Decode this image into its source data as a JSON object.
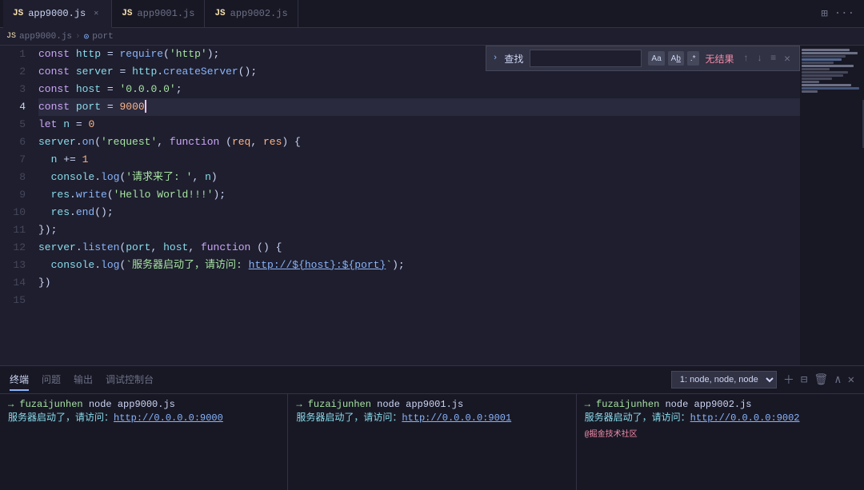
{
  "tabs": [
    {
      "id": "app9000",
      "icon": "JS",
      "label": "app9000.js",
      "active": true,
      "closable": true
    },
    {
      "id": "app9001",
      "icon": "JS",
      "label": "app9001.js",
      "active": false,
      "closable": false
    },
    {
      "id": "app9002",
      "icon": "JS",
      "label": "app9002.js",
      "active": false,
      "closable": false
    }
  ],
  "breadcrumb": {
    "file": "app9000.js",
    "symbol": "port"
  },
  "search": {
    "placeholder": "查找",
    "label": "查找",
    "no_result": "无结果",
    "opt1": "Aa",
    "opt2": "Ab",
    "opt3": ".*"
  },
  "code_lines": [
    {
      "num": 1,
      "content_html": "<span class='kw'>const</span> <span class='var-name'>http</span> <span class='op'>=</span> <span class='fn'>require</span><span class='punc'>(</span><span class='str'>'http'</span><span class='punc'>);</span>"
    },
    {
      "num": 2,
      "content_html": "<span class='kw'>const</span> <span class='var-name'>server</span> <span class='op'>=</span> <span class='var-name'>http</span><span class='punc'>.</span><span class='fn'>createServer</span><span class='punc'>();</span>"
    },
    {
      "num": 3,
      "content_html": "<span class='kw'>const</span> <span class='var-name'>host</span> <span class='op'>=</span> <span class='str'>'0.0.0.0'</span><span class='punc'>;</span>"
    },
    {
      "num": 4,
      "content_html": "<span class='kw'>const</span> <span class='var-name'>port</span> <span class='op'>=</span> <span class='num'>9000</span><span class='cursor'></span>",
      "active": true
    },
    {
      "num": 5,
      "content_html": "<span class='kw'>let</span> <span class='var-name'>n</span> <span class='op'>=</span> <span class='num'>0</span>"
    },
    {
      "num": 6,
      "content_html": "<span class='var-name'>server</span><span class='punc'>.</span><span class='fn'>on</span><span class='punc'>(</span><span class='str'>'request'</span><span class='punc'>,</span> <span class='kw'>function</span> <span class='punc'>(</span><span class='param'>req</span><span class='punc'>,</span> <span class='param'>res</span><span class='punc'>)</span> <span class='punc'>{</span>"
    },
    {
      "num": 7,
      "content_html": "  <span class='var-name'>n</span> <span class='op'>+=</span> <span class='num'>1</span>"
    },
    {
      "num": 8,
      "content_html": "  <span class='var-name'>console</span><span class='punc'>.</span><span class='fn'>log</span><span class='punc'>(</span><span class='str'>'请求来了: '</span><span class='punc'>,</span> <span class='var-name'>n</span><span class='punc'>)</span>"
    },
    {
      "num": 9,
      "content_html": "  <span class='var-name'>res</span><span class='punc'>.</span><span class='fn'>write</span><span class='punc'>(</span><span class='str'>'Hello World!!!'</span><span class='punc'>);</span>"
    },
    {
      "num": 10,
      "content_html": "  <span class='var-name'>res</span><span class='punc'>.</span><span class='fn'>end</span><span class='punc'>();</span>"
    },
    {
      "num": 11,
      "content_html": "<span class='punc'>});</span>"
    },
    {
      "num": 12,
      "content_html": "<span class='var-name'>server</span><span class='punc'>.</span><span class='fn'>listen</span><span class='punc'>(</span><span class='var-name'>port</span><span class='punc'>,</span> <span class='var-name'>host</span><span class='punc'>,</span> <span class='kw'>function</span> <span class='punc'>()</span> <span class='punc'>{</span>"
    },
    {
      "num": 13,
      "content_html": "  <span class='var-name'>console</span><span class='punc'>.</span><span class='fn'>log</span><span class='punc'>(</span><span class='template'>`服务器启动了，请访问: <span class='url-link'>http://${host}:${port}</span>`</span><span class='punc'>);</span>"
    },
    {
      "num": 14,
      "content_html": "<span class='punc'>})</span>"
    },
    {
      "num": 15,
      "content_html": ""
    }
  ],
  "panel_tabs": [
    {
      "id": "terminal",
      "label": "终端",
      "active": true
    },
    {
      "id": "problems",
      "label": "问题",
      "active": false
    },
    {
      "id": "output",
      "label": "输出",
      "active": false
    },
    {
      "id": "debug",
      "label": "调试控制台",
      "active": false
    }
  ],
  "terminal_select": "1: node, node, node",
  "terminals": [
    {
      "prompt": "→  fuzaijunhen",
      "cmd": " node app9000.js",
      "output1": "服务器启动了，请访问：",
      "link": "http://0.0.0.0:9000"
    },
    {
      "prompt": "→  fuzaijunhen",
      "cmd": " node app9001.js",
      "output1": "服务器启动了，请访问：",
      "link": "http://0.0.0.0:9001"
    },
    {
      "prompt": "→  fuzaijunhen",
      "cmd": " node app9002.js",
      "output1": "服务器启动了，请访问：",
      "link": "http://0.0.0.0:9002",
      "footer": "@掘金技术社区"
    }
  ],
  "minimap_colors": [
    "#45475a",
    "#6c7086",
    "#585b70",
    "#45475a",
    "#313244"
  ]
}
